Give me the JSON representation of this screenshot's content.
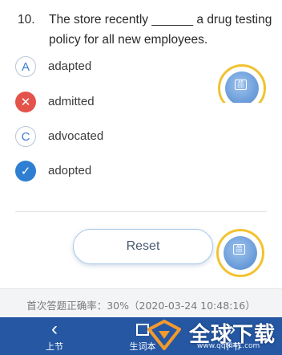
{
  "question": {
    "number": "10.",
    "text": "The store recently ______ a drug testing policy for all new employees."
  },
  "options": [
    {
      "badge": "A",
      "state": "letter",
      "label": "adapted"
    },
    {
      "badge": "✕",
      "state": "wrong",
      "label": "admitted"
    },
    {
      "badge": "C",
      "state": "letter",
      "label": "advocated"
    },
    {
      "badge": "✓",
      "state": "correct",
      "label": "adopted"
    }
  ],
  "answer_card": {
    "icon": "answer-card-icon",
    "glyph": "AB CD"
  },
  "reset": {
    "label": "Reset"
  },
  "stats": {
    "text": "首次答题正确率：30%（2020-03-24 10:48:16）"
  },
  "bottom_nav": {
    "prev": {
      "label": "上节",
      "icon": "chevron-left-icon",
      "glyph": "‹"
    },
    "vocab": {
      "label": "生词本",
      "icon": "notebook-icon"
    },
    "next": {
      "label": "下节",
      "icon": "chevron-right-icon",
      "glyph": "›"
    }
  },
  "watermark": {
    "text": "全球下载",
    "url": "www.qqtn41.com"
  },
  "colors": {
    "nav_bar": "#2557a3",
    "correct": "#2e7fd2",
    "wrong": "#e4534a",
    "card_ring": "#f2c230"
  }
}
